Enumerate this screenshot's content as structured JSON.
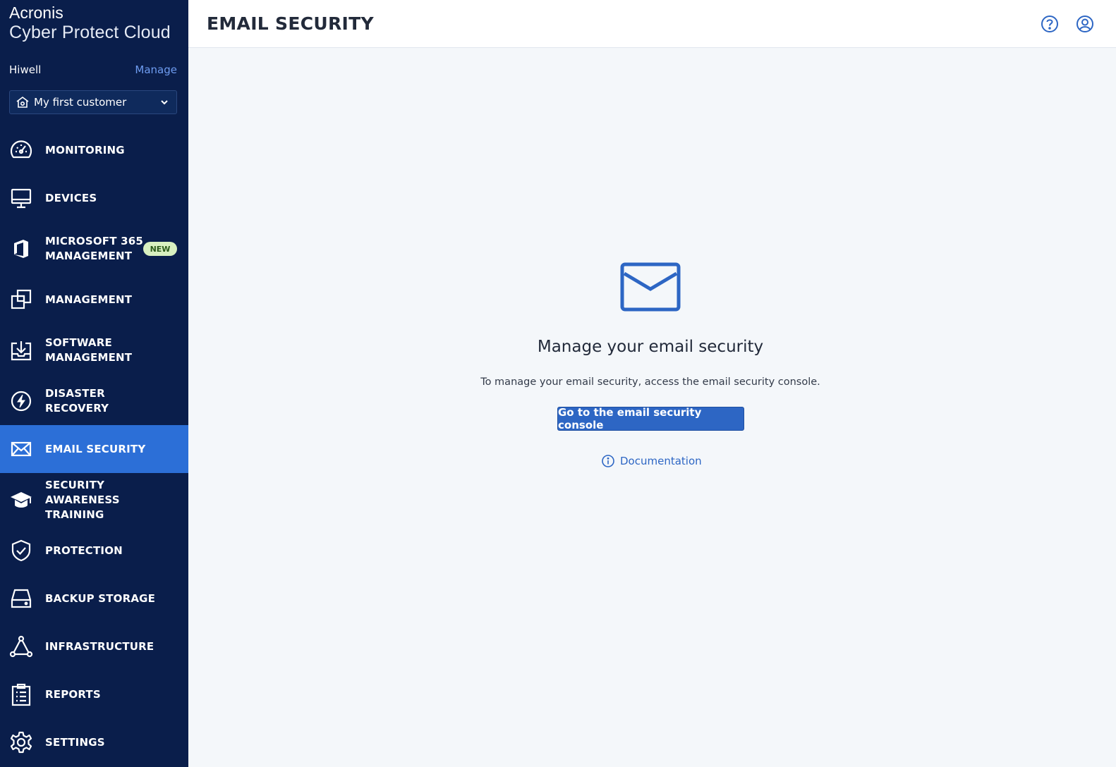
{
  "brand": {
    "name": "Acronis",
    "product": "Cyber Protect Cloud"
  },
  "tenant": {
    "name": "Hiwell",
    "manage_label": "Manage"
  },
  "customer_select": {
    "value": "My first customer",
    "icon": "home-icon"
  },
  "nav": {
    "items": [
      {
        "label": "MONITORING",
        "icon": "gauge-icon"
      },
      {
        "label": "DEVICES",
        "icon": "monitor-icon"
      },
      {
        "label": "MICROSOFT 365 MANAGEMENT",
        "icon": "office-icon",
        "badge": "NEW"
      },
      {
        "label": "MANAGEMENT",
        "icon": "stacked-squares-icon"
      },
      {
        "label": "SOFTWARE MANAGEMENT",
        "icon": "download-box-icon"
      },
      {
        "label": "DISASTER RECOVERY",
        "icon": "lightning-icon"
      },
      {
        "label": "EMAIL SECURITY",
        "icon": "envelope-icon",
        "active": true
      },
      {
        "label": "SECURITY AWARENESS TRAINING",
        "icon": "graduation-cap-icon"
      },
      {
        "label": "PROTECTION",
        "icon": "shield-check-icon"
      },
      {
        "label": "BACKUP STORAGE",
        "icon": "drive-icon"
      },
      {
        "label": "INFRASTRUCTURE",
        "icon": "network-triangle-icon"
      },
      {
        "label": "REPORTS",
        "icon": "clipboard-icon"
      },
      {
        "label": "SETTINGS",
        "icon": "gear-icon"
      }
    ]
  },
  "header": {
    "title": "EMAIL SECURITY",
    "help_icon": "help-icon",
    "user_icon": "user-icon"
  },
  "main": {
    "heading": "Manage your email security",
    "description": "To manage your email security, access the email security console.",
    "cta_label": "Go to the email security console",
    "doc_link_label": "Documentation"
  },
  "colors": {
    "sidebar_bg": "#0a1e4b",
    "active_nav": "#2c6fd7",
    "accent": "#2d66c4",
    "page_bg": "#f4f7fa",
    "badge_bg": "#d8f0c0"
  }
}
